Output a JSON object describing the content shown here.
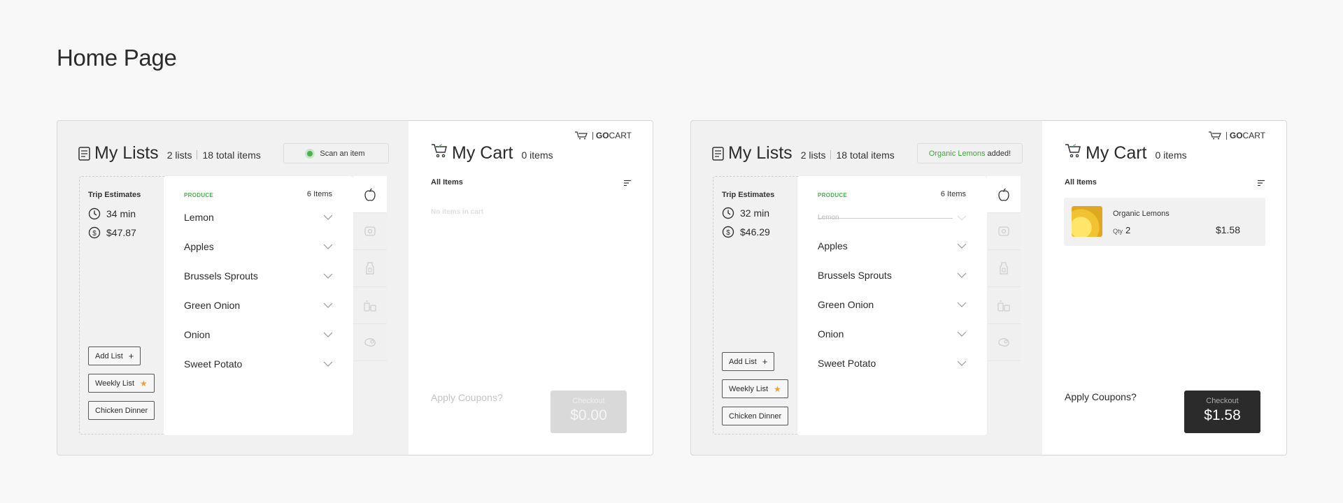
{
  "page": {
    "title": "Home Page"
  },
  "frames": [
    {
      "lists": {
        "title": "My Lists",
        "lists_count": "2 lists",
        "items_total": "18 total items"
      },
      "pill": {
        "label": "Scan an item"
      },
      "trip": {
        "label": "Trip Estimates",
        "time": "34 min",
        "cost": "$47.87"
      },
      "buttons": {
        "add_list": "Add List",
        "weekly": "Weekly List",
        "chicken": "Chicken Dinner"
      },
      "category": {
        "name": "PRODUCE",
        "count": "6 Items"
      },
      "items": [
        "Lemon",
        "Apples",
        "Brussels Sprouts",
        "Green Onion",
        "Onion",
        "Sweet Potato"
      ],
      "cart": {
        "brand_go": "GO",
        "brand_cart": "CART",
        "title": "My Cart",
        "count": "0 items",
        "filter_label": "All Items",
        "empty_text": "No items in cart",
        "coupons": "Apply Coupons?",
        "checkout_label": "Checkout",
        "checkout_total": "$0.00"
      }
    },
    {
      "lists": {
        "title": "My Lists",
        "lists_count": "2 lists",
        "items_total": "18 total items"
      },
      "pill": {
        "highlight": "Organic Lemons",
        "label": "added!"
      },
      "trip": {
        "label": "Trip Estimates",
        "time": "32 min",
        "cost": "$46.29"
      },
      "buttons": {
        "add_list": "Add List",
        "weekly": "Weekly List",
        "chicken": "Chicken Dinner"
      },
      "category": {
        "name": "PRODUCE",
        "count": "6 Items"
      },
      "items": [
        "Lemon",
        "Apples",
        "Brussels Sprouts",
        "Green Onion",
        "Onion",
        "Sweet Potato"
      ],
      "cart": {
        "brand_go": "GO",
        "brand_cart": "CART",
        "title": "My Cart",
        "count": "0 items",
        "filter_label": "All Items",
        "item": {
          "name": "Organic Lemons",
          "qty_label": "Qty",
          "qty": "2",
          "price": "$1.58"
        },
        "coupons": "Apply Coupons?",
        "checkout_label": "Checkout",
        "checkout_total": "$1.58"
      }
    }
  ],
  "colors": {
    "accent_green": "#4caf50",
    "star": "#f0a030",
    "dark": "#2b2b2b"
  },
  "icons": [
    "list-doc-icon",
    "clock-icon",
    "dollar-icon",
    "plus-icon",
    "star-icon",
    "chevron-down-icon",
    "apple-icon",
    "cart-icon",
    "filter-icon",
    "gocart-logo-icon"
  ]
}
